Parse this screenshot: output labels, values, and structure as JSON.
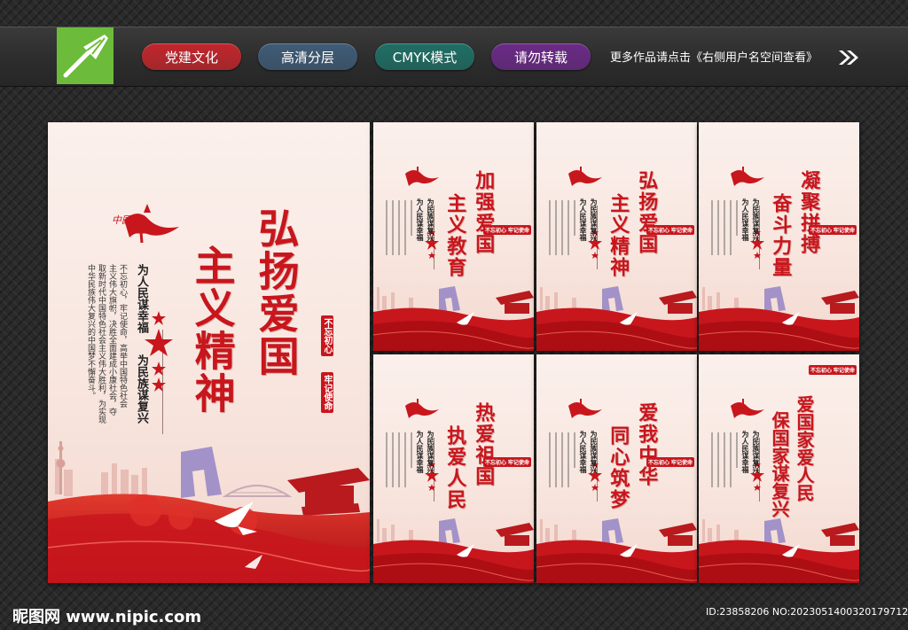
{
  "header": {
    "pills": [
      {
        "label": "党建文化",
        "color": "#c0262c"
      },
      {
        "label": "高清分层",
        "color": "#3f5b76"
      },
      {
        "label": "CMYK模式",
        "color": "#1f6e64"
      },
      {
        "label": "请勿转载",
        "color": "#6a2a86"
      }
    ],
    "promo_text": "更多作品请点击《右侧用户名空间查看》",
    "logo_icon": "pen-nib-icon",
    "arrow_icon": "double-chevron-right-icon"
  },
  "colors": {
    "accent_red": "#c8161d",
    "poster_bg": "#f8e6df",
    "logo_green": "#6dbb3a"
  },
  "main_poster": {
    "logo_text": "中国梦",
    "title_lines": [
      "弘扬爱国",
      "主义精神"
    ],
    "slogan_left": "为人民谋幸福",
    "slogan_right": "为民族谋复兴",
    "seal_left": "不忘初心",
    "seal_right": "牢记使命",
    "body_lines": [
      "不忘初心，牢记使命，高举中国特色社会",
      "主义伟大旗帜，决胜全面建成小康社会，夺",
      "取新时代中国特色社会主义伟大胜利，为实现",
      "中华民族伟大复兴的中国梦不懈奋斗。"
    ]
  },
  "small_posters": [
    {
      "title_lines": [
        "加强爱国",
        "主义教育"
      ]
    },
    {
      "title_lines": [
        "弘扬爱国",
        "主义精神"
      ]
    },
    {
      "title_lines": [
        "凝聚拼搏",
        "奋斗力量"
      ]
    },
    {
      "title_lines": [
        "热爱祖国",
        "执爱人民"
      ]
    },
    {
      "title_lines": [
        "爱我中华",
        "同心筑梦"
      ]
    },
    {
      "title_lines": [
        "爱国家爱人民",
        "保国家谋复兴"
      ]
    }
  ],
  "footer": {
    "site": "昵图网 www.nipic.com",
    "image_id": "ID:23858206 NO:20230514003201797121"
  }
}
